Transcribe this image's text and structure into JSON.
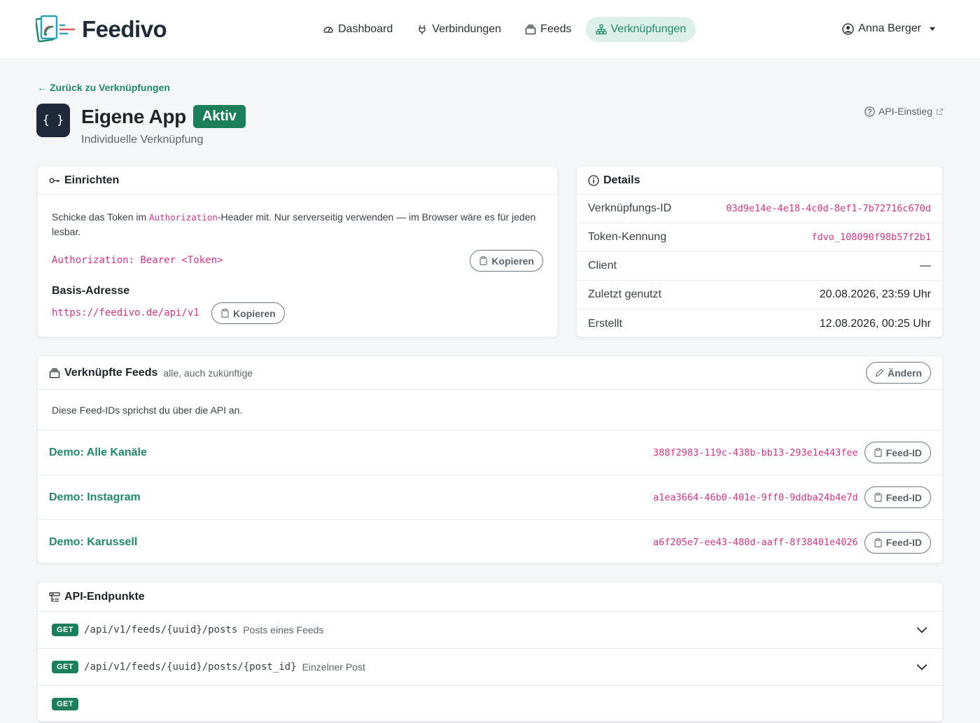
{
  "brand": {
    "name": "Feedivo"
  },
  "nav": {
    "items": [
      {
        "label": "Dashboard",
        "icon": "gauge-icon"
      },
      {
        "label": "Verbindungen",
        "icon": "plug-icon"
      },
      {
        "label": "Feeds",
        "icon": "collection-icon"
      },
      {
        "label": "Verknüpfungen",
        "icon": "diagram-icon",
        "active": true
      }
    ],
    "user": "Anna Berger"
  },
  "header": {
    "back_link": "Zurück zu Verknüpfungen",
    "app_icon_text": "{ }",
    "title": "Eigene App",
    "status": "Aktiv",
    "subtitle": "Individuelle Verknüpfung",
    "api_link": "API-Einstieg"
  },
  "setup": {
    "title": "Einrichten",
    "text_before": "Schicke das Token im ",
    "text_code": "Authorization",
    "text_after": "-Header mit. Nur serverseitig verwenden — im Browser wäre es für jeden lesbar.",
    "auth_line": "Authorization: Bearer <Token>",
    "copy_label": "Kopieren",
    "base_label": "Basis-Adresse",
    "base_url": "https://feedivo.de/api/v1"
  },
  "details": {
    "title": "Details",
    "rows": [
      {
        "label": "Verknüpfungs-ID",
        "value": "03d9e14e-4e18-4c0d-8ef1-7b72716c670d",
        "code": true
      },
      {
        "label": "Token-Kennung",
        "value": "fdvo_108090f98b57f2b1",
        "code": true
      },
      {
        "label": "Client",
        "value": "—",
        "code": false
      },
      {
        "label": "Zuletzt genutzt",
        "value": "20.08.2026, 23:59 Uhr",
        "code": false
      },
      {
        "label": "Erstellt",
        "value": "12.08.2026, 00:25 Uhr",
        "code": false
      }
    ]
  },
  "feeds": {
    "title": "Verknüpfte Feeds",
    "subtitle": "alle, auch zukünftige",
    "change_label": "Ändern",
    "hint": "Diese Feed-IDs sprichst du über die API an.",
    "copy_label": "Feed-ID",
    "items": [
      {
        "name": "Demo: Alle Kanäle",
        "id": "388f2983-119c-438b-bb13-293e1e443fee"
      },
      {
        "name": "Demo: Instagram",
        "id": "a1ea3664-46b0-401e-9ff0-9ddba24b4e7d"
      },
      {
        "name": "Demo: Karussell",
        "id": "a6f205e7-ee43-480d-aaff-8f38401e4026"
      }
    ]
  },
  "endpoints": {
    "title": "API-Endpunkte",
    "items": [
      {
        "method": "GET",
        "path": "/api/v1/feeds/{uuid}/posts",
        "desc": "Posts eines Feeds"
      },
      {
        "method": "GET",
        "path": "/api/v1/feeds/{uuid}/posts/{post_id}",
        "desc": "Einzelner Post"
      },
      {
        "method": "GET",
        "path": "",
        "desc": ""
      }
    ]
  },
  "colors": {
    "accent": "#1f8a6a",
    "success": "#1a7f5a",
    "code": "#d63384",
    "dark": "#1e293b"
  }
}
